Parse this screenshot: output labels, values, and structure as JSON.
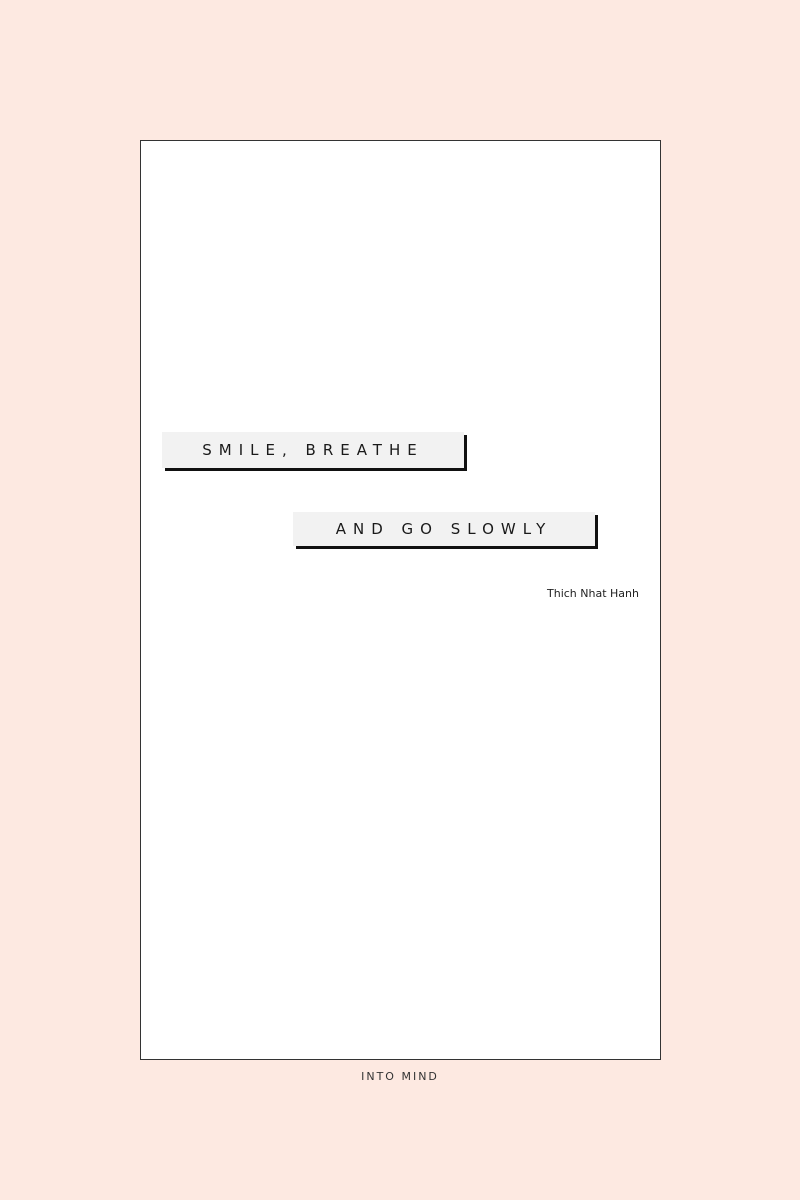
{
  "quote": {
    "line_1": "SMILE, BREATHE",
    "line_2": "AND GO SLOWLY",
    "author": "Thich Nhat Hanh"
  },
  "footer": {
    "brand": "INTO MIND"
  },
  "colors": {
    "background": "#fde9e1",
    "card": "#ffffff",
    "label_box": "#f2f2f2",
    "label_shadow": "#111111",
    "text": "#1a1a1a"
  }
}
